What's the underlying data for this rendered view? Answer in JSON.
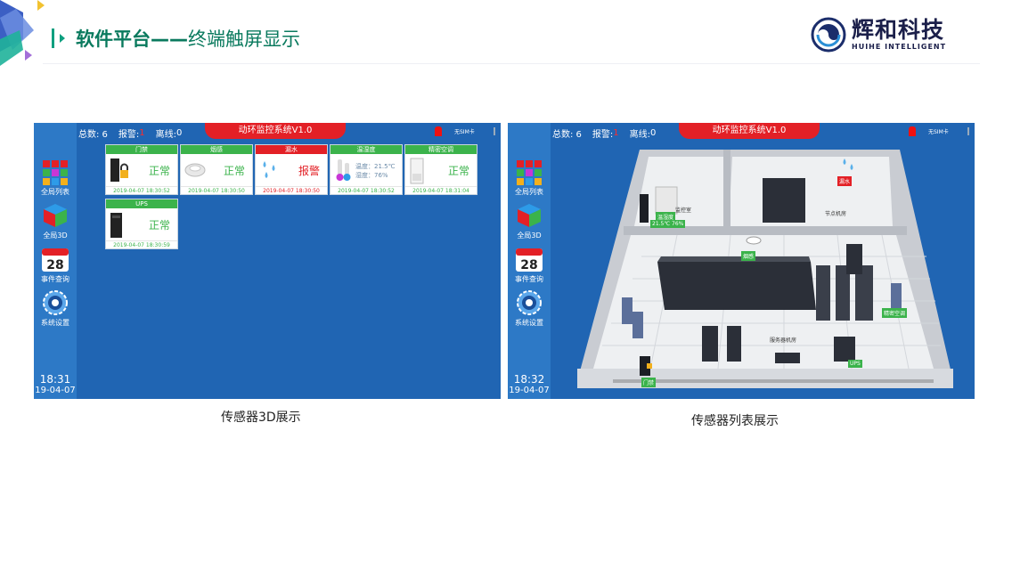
{
  "slide": {
    "title_main": "软件平台——",
    "title_sub": "终端触屏显示",
    "logo_cn": "辉和科技",
    "logo_en": "HUIHE INTELLIGENT",
    "colors": {
      "accent": "#0a7a5e",
      "screen_bg": "#2065b3",
      "normal": "#3bb34b",
      "alarm": "#e32026"
    }
  },
  "panels": [
    {
      "caption": "传感器3D展示",
      "topbar": {
        "total": "总数: 6",
        "alarm": "报警:",
        "alarm_count": "1",
        "offline": "离线:",
        "offline_count": "0"
      },
      "banner": "动环监控系统V1.0",
      "sim": "无SIM卡",
      "sidebar": [
        "全局列表",
        "全局3D",
        "事件查询",
        "系统设置"
      ],
      "calendar_day": "28",
      "clock": {
        "time": "18:31",
        "date": "19-04-07"
      },
      "tiles": [
        {
          "name": "门禁",
          "status": "正常",
          "time": "2019-04-07 18:30:52",
          "alarm": false,
          "icon": "lock-icon"
        },
        {
          "name": "烟感",
          "status": "正常",
          "time": "2019-04-07 18:30:50",
          "alarm": false,
          "icon": "smoke-detector-icon"
        },
        {
          "name": "漏水",
          "status": "报警",
          "time": "2019-04-07 18:30:50",
          "alarm": true,
          "icon": "water-leak-icon"
        },
        {
          "name": "温湿度",
          "temp": "温度：21.5℃",
          "hum": "湿度：76%",
          "time": "2019-04-07 18:30:52",
          "alarm": false,
          "icon": "thermometer-icon"
        },
        {
          "name": "精密空调",
          "status": "正常",
          "time": "2019-04-07 18:31:04",
          "alarm": false,
          "icon": "air-conditioner-icon"
        },
        {
          "name": "UPS",
          "status": "正常",
          "time": "2019-04-07 18:30:59",
          "alarm": false,
          "icon": "ups-icon"
        }
      ]
    },
    {
      "caption": "传感器列表展示",
      "topbar": {
        "total": "总数: 6",
        "alarm": "报警:",
        "alarm_count": "1",
        "offline": "离线:",
        "offline_count": "0"
      },
      "banner": "动环监控系统V1.0",
      "sim": "无SIM卡",
      "sidebar": [
        "全局列表",
        "全局3D",
        "事件查询",
        "系统设置"
      ],
      "calendar_day": "28",
      "clock": {
        "time": "18:32",
        "date": "19-04-07"
      },
      "rooms": {
        "room1": "监控室",
        "room2": "节点机房",
        "room3": "服务器机房"
      },
      "markers": {
        "temphum": "温湿度",
        "temphum_value": "21.5℃ 76%",
        "water": "漏水",
        "smoke": "烟感",
        "ac": "精密空调",
        "ups": "UPS",
        "door": "门禁"
      }
    }
  ]
}
